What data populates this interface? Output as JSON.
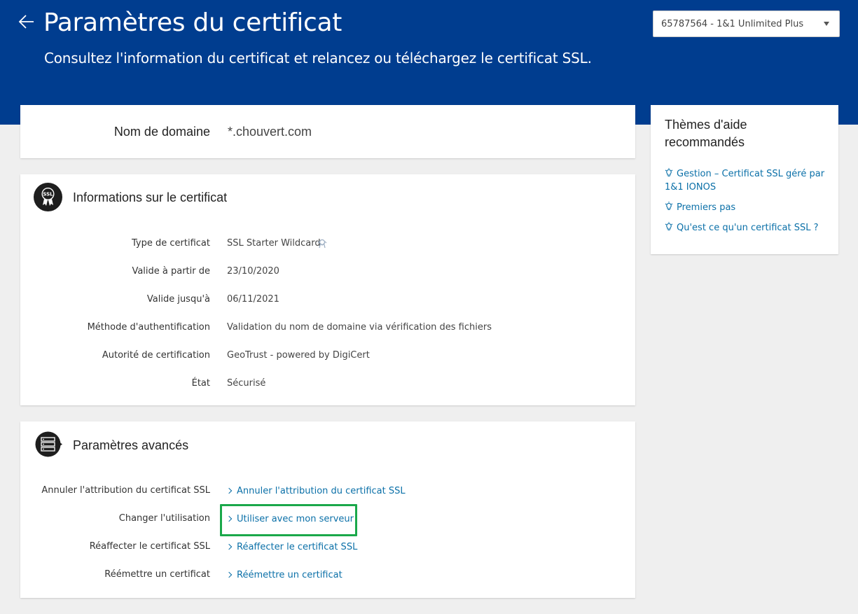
{
  "header": {
    "title": "Paramètres du certificat",
    "subtitle": "Consultez l'information du certificat et relancez ou téléchargez le certificat SSL.",
    "contract_select": "65787564 - 1&1 Unlimited Plus"
  },
  "domain": {
    "label": "Nom de domaine",
    "value": "*.chouvert.com"
  },
  "info": {
    "title": "Informations sur le certificat",
    "icon_text": "SSL",
    "rows": [
      {
        "label": "Type de certificat",
        "value": "SSL Starter Wildcard"
      },
      {
        "label": "Valide à partir de",
        "value": "23/10/2020"
      },
      {
        "label": "Valide jusqu'à",
        "value": "06/11/2021"
      },
      {
        "label": "Méthode d'authentification",
        "value": "Validation du nom de domaine via vérification des fichiers"
      },
      {
        "label": "Autorité de certification",
        "value": "GeoTrust - powered by DigiCert"
      },
      {
        "label": "État",
        "value": "Sécurisé"
      }
    ]
  },
  "advanced": {
    "title": "Paramètres avancés",
    "rows": [
      {
        "label": "Annuler l'attribution du certificat SSL",
        "link": "Annuler l'attribution du certificat SSL"
      },
      {
        "label": "Changer l'utilisation",
        "link": "Utiliser avec mon serveur"
      },
      {
        "label": "Réaffecter le certificat SSL",
        "link": "Réaffecter le certificat SSL"
      },
      {
        "label": "Réémettre un certificat",
        "link": "Réémettre un certificat"
      }
    ]
  },
  "help": {
    "title": "Thèmes d'aide recommandés",
    "links": [
      "Gestion – Certificat SSL géré par 1&1 IONOS",
      "Premiers pas",
      "Qu'est ce qu'un certificat SSL ?"
    ]
  },
  "colors": {
    "header_bg": "#003d8f",
    "link": "#0b70a8",
    "highlight": "#1aa84a"
  }
}
